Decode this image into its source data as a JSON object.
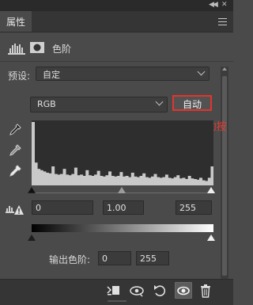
{
  "panel": {
    "tab_label": "属性",
    "title": "色阶"
  },
  "preset": {
    "label": "预设:",
    "value": "自定"
  },
  "channel": {
    "value": "RGB"
  },
  "auto_button": {
    "label": "自动"
  },
  "annotation": {
    "text": "按住Alt键并单击自动按钮",
    "color": "#e63a30"
  },
  "input_levels": {
    "black": "0",
    "gamma": "1.00",
    "white": "255"
  },
  "output_levels": {
    "label": "输出色阶:",
    "black": "0",
    "white": "255"
  },
  "icons": {
    "top": [
      "collapse-icon",
      "close-icon",
      "panel-menu-icon"
    ],
    "header": [
      "levels-adjustment-icon",
      "layer-mask-icon"
    ],
    "eyedroppers": [
      "black-point-eyedropper-icon",
      "gray-point-eyedropper-icon",
      "white-point-eyedropper-icon"
    ],
    "bottom": [
      "clip-to-layer-icon",
      "view-previous-state-icon",
      "reset-icon",
      "visibility-eye-icon",
      "trash-icon"
    ],
    "warning": "clipping-warning-icon"
  },
  "colors": {
    "panel_bg": "#4a4a4a",
    "accent_red": "#e2342c"
  },
  "chart_data": {
    "type": "bar",
    "x": [
      0,
      255
    ],
    "values": [
      100,
      36,
      26,
      24,
      22,
      20,
      19,
      30,
      18,
      17,
      18,
      26,
      17,
      16,
      18,
      28,
      16,
      17,
      15,
      24,
      16,
      15,
      17,
      23,
      15,
      14,
      16,
      22,
      15,
      14,
      15,
      21,
      14,
      15,
      13,
      20,
      14,
      13,
      15,
      19,
      13,
      12,
      14,
      18,
      13,
      12,
      13,
      17,
      12,
      11,
      13,
      16,
      11,
      12,
      10,
      15,
      11,
      10,
      9,
      12,
      8,
      7,
      12,
      30
    ],
    "title": "",
    "xlabel": "",
    "ylabel": ""
  }
}
